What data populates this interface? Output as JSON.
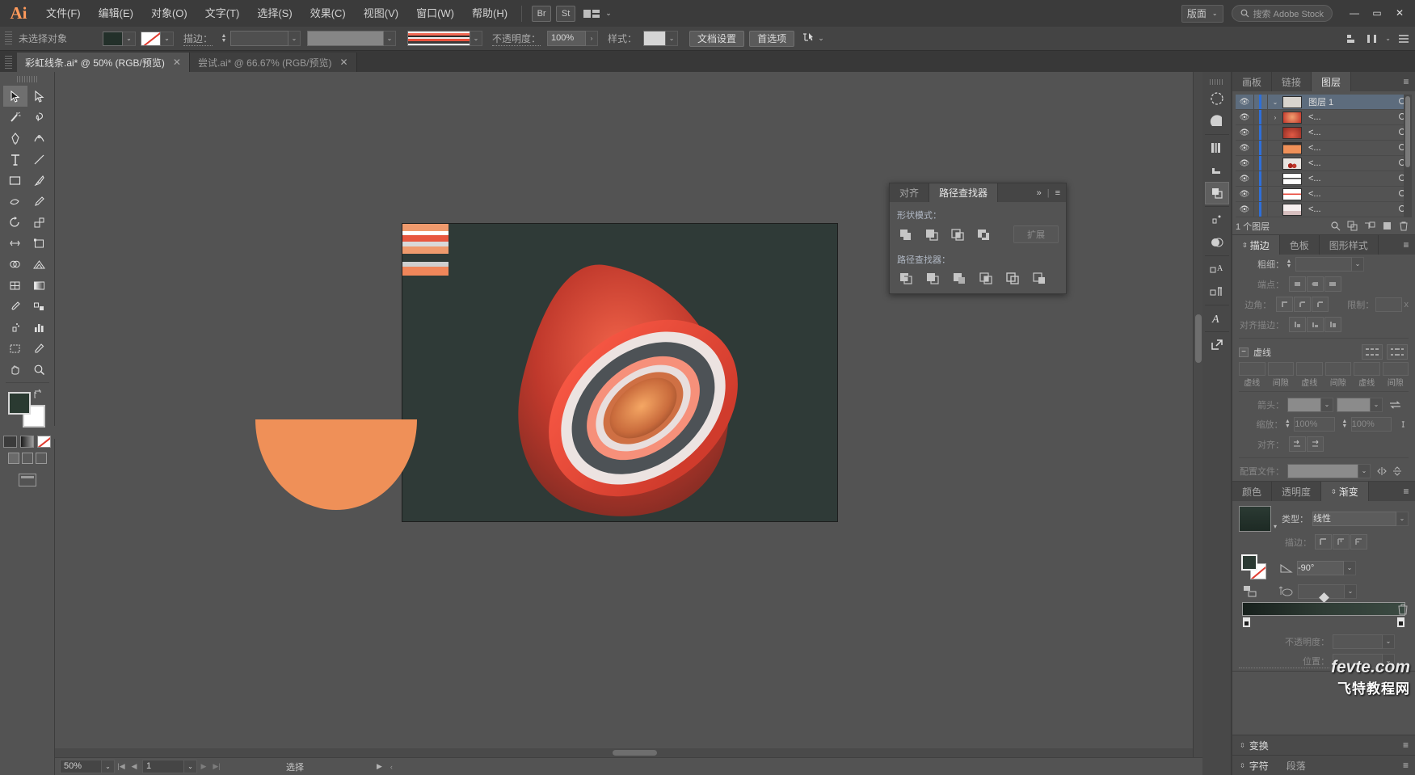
{
  "menubar": {
    "logo": "Ai",
    "items": [
      "文件(F)",
      "编辑(E)",
      "对象(O)",
      "文字(T)",
      "选择(S)",
      "效果(C)",
      "视图(V)",
      "窗口(W)",
      "帮助(H)"
    ],
    "bridge_button": "Br",
    "stock_button": "St",
    "workspace_label": "版面",
    "search_placeholder": "搜索 Adobe Stock",
    "minimize": "—",
    "maximize": "▭",
    "close": "✕"
  },
  "controlbar": {
    "selection_status": "未选择对象",
    "fill_color": "#23302a",
    "stroke_label": "描边：",
    "stroke_weight": "",
    "opacity_label": "不透明度：",
    "opacity_value": "100%",
    "style_label": "样式：",
    "document_setup": "文档设置",
    "preferences": "首选项"
  },
  "tabs": [
    {
      "title": "彩虹线条.ai* @ 50% (RGB/预览)",
      "active": true,
      "close": "✕"
    },
    {
      "title": "尝试.ai* @ 66.67% (RGB/预览)",
      "active": false,
      "close": "✕"
    }
  ],
  "tools": [
    {
      "name": "selection-tool",
      "selected": true
    },
    {
      "name": "direct-selection-tool",
      "selected": false
    },
    {
      "name": "magic-wand-tool",
      "selected": false
    },
    {
      "name": "lasso-tool",
      "selected": false
    },
    {
      "name": "pen-tool",
      "selected": false
    },
    {
      "name": "curvature-tool",
      "selected": false
    },
    {
      "name": "type-tool",
      "selected": false
    },
    {
      "name": "line-segment-tool",
      "selected": false
    },
    {
      "name": "rectangle-tool",
      "selected": false
    },
    {
      "name": "paintbrush-tool",
      "selected": false
    },
    {
      "name": "shaper-tool",
      "selected": false
    },
    {
      "name": "pencil-tool",
      "selected": false
    },
    {
      "name": "rotate-tool",
      "selected": false
    },
    {
      "name": "scale-tool",
      "selected": false
    },
    {
      "name": "width-tool",
      "selected": false
    },
    {
      "name": "free-transform-tool",
      "selected": false
    },
    {
      "name": "shape-builder-tool",
      "selected": false
    },
    {
      "name": "perspective-grid-tool",
      "selected": false
    },
    {
      "name": "mesh-tool",
      "selected": false
    },
    {
      "name": "gradient-tool",
      "selected": false
    },
    {
      "name": "eyedropper-tool",
      "selected": false
    },
    {
      "name": "blend-tool",
      "selected": false
    },
    {
      "name": "symbol-sprayer-tool",
      "selected": false
    },
    {
      "name": "column-graph-tool",
      "selected": false
    },
    {
      "name": "artboard-tool",
      "selected": false
    },
    {
      "name": "slice-tool",
      "selected": false
    },
    {
      "name": "hand-tool",
      "selected": false
    },
    {
      "name": "zoom-tool",
      "selected": false
    }
  ],
  "canvas": {
    "artboard_bg": "#2f3a37",
    "swatch_strips": [
      "#ef9a6d",
      "#ffffff",
      "#e8573f",
      "#d9d9d9",
      "#ef9a6d",
      "#cfcfcf",
      "#f0865a"
    ],
    "half_disc_color": "#ef9058",
    "cone_colors": [
      "#f04030",
      "#e8e0de",
      "#4a4f52",
      "#f08a64",
      "#c1392c",
      "#d9713f"
    ]
  },
  "statusbar": {
    "zoom": "50%",
    "first": "|◀",
    "prev": "◀",
    "page": "1",
    "next": "▶",
    "last": "▶|",
    "status_text": "选择"
  },
  "pathfinder": {
    "tabs": [
      {
        "label": "对齐",
        "active": false
      },
      {
        "label": "路径查找器",
        "active": true
      }
    ],
    "collapse": "»",
    "menu": "≡",
    "shape_modes_label": "形状模式：",
    "expand_button": "扩展",
    "pathfinders_label": "路径查找器：",
    "shape_mode_buttons": [
      "unite-icon",
      "minus-front-icon",
      "intersect-icon",
      "exclude-icon"
    ],
    "pathfinder_buttons": [
      "divide-icon",
      "trim-icon",
      "merge-icon",
      "crop-icon",
      "outline-icon",
      "minus-back-icon"
    ]
  },
  "layers_panel": {
    "tabs": [
      {
        "label": "画板",
        "active": false
      },
      {
        "label": "链接",
        "active": false
      },
      {
        "label": "图层",
        "active": true
      }
    ],
    "menu": "≡",
    "rows": [
      {
        "name": "图层 1",
        "thumb": "#d8d4ce",
        "selected": true,
        "expanded": true,
        "is_layer": true
      },
      {
        "name": "<...",
        "thumb": "#c3342a",
        "selected": false,
        "expanded": false,
        "is_layer": false
      },
      {
        "name": "<...",
        "thumb": "#b8322a",
        "selected": false,
        "expanded": false,
        "is_layer": false
      },
      {
        "name": "<...",
        "thumb": "#ef9058",
        "selected": false,
        "expanded": false,
        "is_layer": false
      },
      {
        "name": "<...",
        "thumb": "#6b3028",
        "selected": false,
        "expanded": false,
        "is_layer": false
      },
      {
        "name": "<...",
        "thumb": "#ffffff",
        "selected": false,
        "expanded": false,
        "is_layer": false
      },
      {
        "name": "<...",
        "thumb": "#ffffff",
        "selected": false,
        "expanded": false,
        "is_layer": false
      },
      {
        "name": "<...",
        "thumb": "#e7dcdc",
        "selected": false,
        "expanded": false,
        "is_layer": false
      }
    ],
    "footer_count": "1 个图层",
    "footer_icons": [
      "locate-object-icon",
      "make-sublayer-icon",
      "make-clipping-mask-icon",
      "new-layer-icon",
      "delete-layer-icon"
    ]
  },
  "stroke_panel": {
    "tabs": [
      {
        "label": "描边",
        "active": true
      },
      {
        "label": "色板",
        "active": false
      },
      {
        "label": "图形样式",
        "active": false
      }
    ],
    "menu": "≡",
    "weight_label": "粗细：",
    "weight_value": "",
    "cap_label": "端点：",
    "corner_label": "边角：",
    "limit_label": "限制：",
    "limit_unit": "x",
    "align_stroke_label": "对齐描边：",
    "dashed_label": "虚线",
    "dash_fields": [
      "虚线",
      "间隙",
      "虚线",
      "间隙",
      "虚线",
      "间隙"
    ],
    "arrow_label": "箭头：",
    "scale_label": "缩放：",
    "scale_values": [
      "100%",
      "100%"
    ],
    "align_label": "对齐：",
    "profile_label": "配置文件："
  },
  "gradient_panel": {
    "tabs": [
      {
        "label": "颜色",
        "active": false
      },
      {
        "label": "透明度",
        "active": false
      },
      {
        "label": "渐变",
        "active": true
      }
    ],
    "menu": "≡",
    "type_label": "类型：",
    "type_value": "线性",
    "stroke_label": "描边：",
    "angle_value": "-90°",
    "opacity_label": "不透明度：",
    "location_label": "位置：",
    "gradient_start": "#17201c",
    "gradient_end": "#3b4a42"
  },
  "bottom_panels": {
    "transform": "变换",
    "character": "字符",
    "paragraph": "段落"
  },
  "watermark": {
    "line1": "fevte.com",
    "line2": "飞特教程网"
  }
}
